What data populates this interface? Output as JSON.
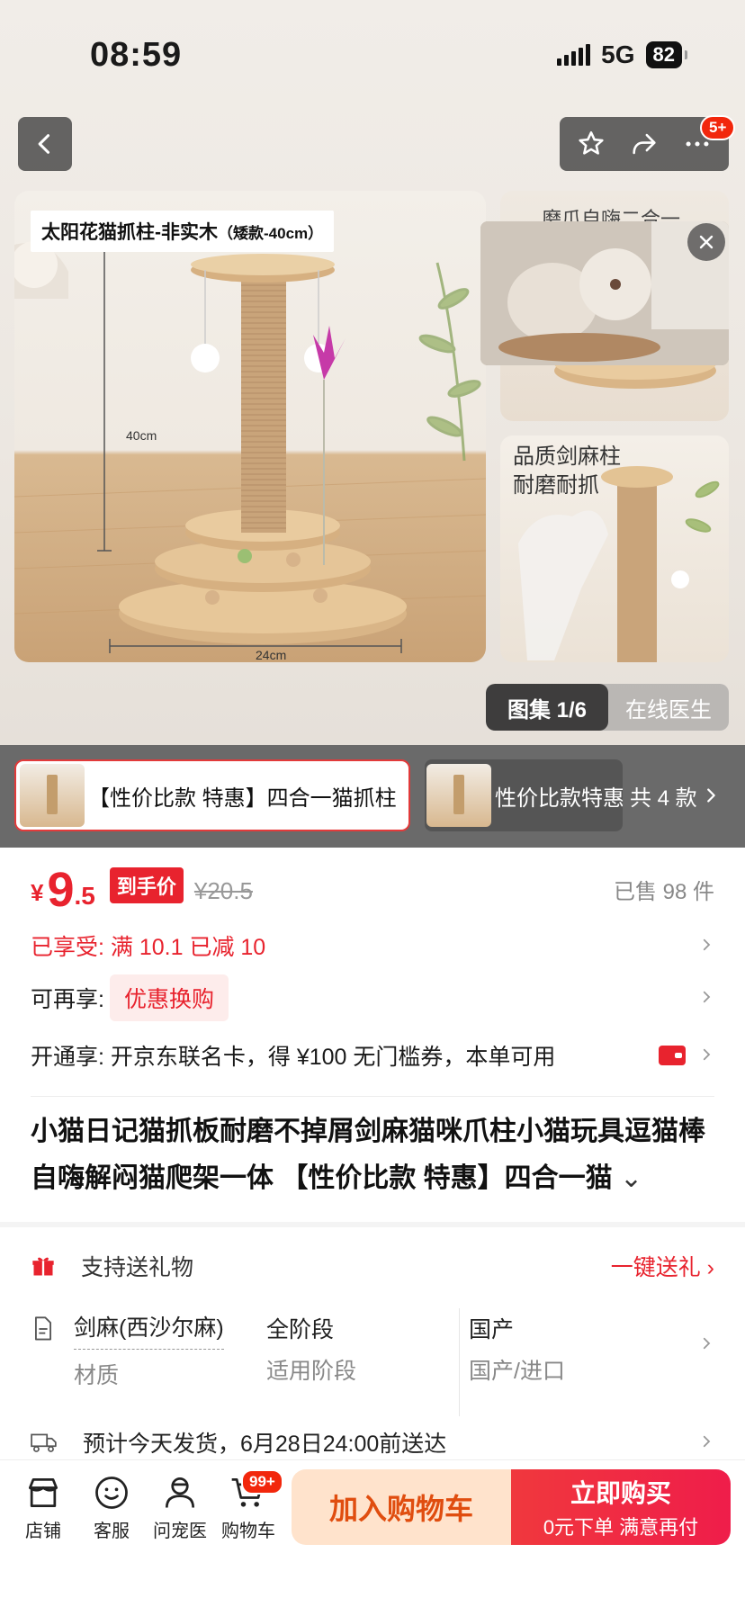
{
  "status": {
    "time": "08:59",
    "network": "5G",
    "battery": "82"
  },
  "nav": {
    "notif_count": "5+"
  },
  "gallery": {
    "main_caption": "太阳花猫抓柱-非实木",
    "main_caption_small": "（矮款-40cm）",
    "height_label": "40cm",
    "width_label": "24cm",
    "side1_label": "磨爪自嗨二合一",
    "side2_label_line1": "品质剑麻柱",
    "side2_label_line2": "耐磨耐抓",
    "pill_active": "图集 1/6",
    "pill_other": "在线医生"
  },
  "variants": {
    "items": [
      {
        "label": "【性价比款 特惠】四合一猫抓柱"
      },
      {
        "label": "性价比款特惠"
      }
    ],
    "more_label": "共 4 款"
  },
  "price": {
    "currency": "¥",
    "integer": "9",
    "decimal": ".5",
    "tag": "到手价",
    "original": "¥20.5",
    "sold": "已售 98 件"
  },
  "promo": {
    "enjoyed": "已享受: 满 10.1 已减 10",
    "more_label": "可再享:",
    "more_chip": "优惠换购",
    "open_text": "开通享: 开京东联名卡，得 ¥100 无门槛券，本单可用"
  },
  "product": {
    "title": "小猫日记猫抓板耐磨不掉屑剑麻猫咪爪柱小猫玩具逗猫棒自嗨解闷猫爬架一体 【性价比款 特惠】四合一猫"
  },
  "specs": {
    "gift_label": "支持送礼物",
    "gift_link": "一键送礼",
    "items": [
      {
        "value": "剑麻(西沙尔麻)",
        "key": "材质"
      },
      {
        "value": "全阶段",
        "key": "适用阶段"
      },
      {
        "value": "国产",
        "key": "国产/进口"
      }
    ],
    "shipping": "预计今天发货，6月28日24:00前送达"
  },
  "bottom": {
    "tabs": [
      "店铺",
      "客服",
      "问宠医",
      "购物车"
    ],
    "cart_badge": "99+",
    "add_cart": "加入购物车",
    "buy_main": "立即购买",
    "buy_sub": "0元下单 满意再付"
  },
  "colors": {
    "accent": "#e8232e",
    "cart_btn_bg": "#ffe3cc",
    "cart_btn_text": "#e04d0f"
  }
}
